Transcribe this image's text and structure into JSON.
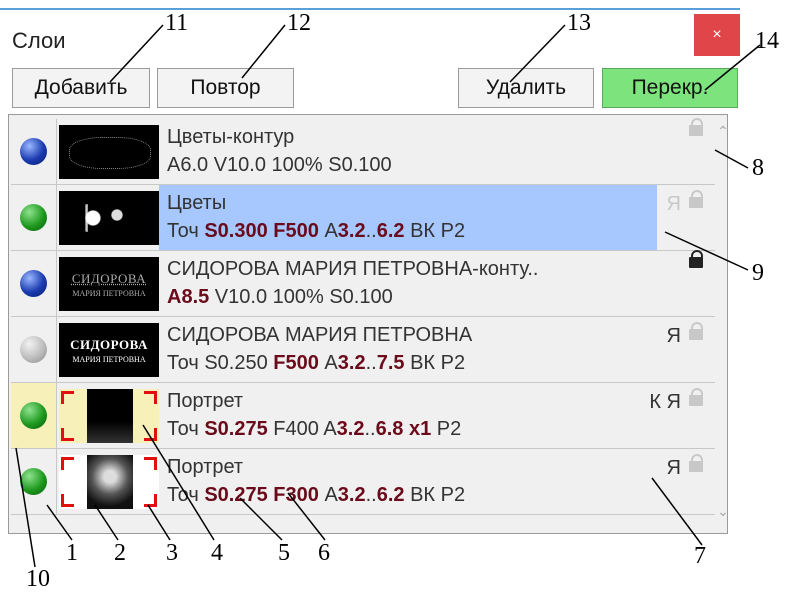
{
  "window": {
    "title": "Слои",
    "close_label": "×"
  },
  "toolbar": {
    "add": "Добавить",
    "repeat": "Повтор",
    "delete": "Удалить",
    "overlap": "Перекр."
  },
  "layers": [
    {
      "dot": "blue",
      "name": "Цветы-контур",
      "params_plain": "A6.0 V10.0 100% S0.100",
      "flags_text": "",
      "lock": "dim",
      "thumb": "flowers-outline"
    },
    {
      "dot": "green",
      "name": "Цветы",
      "params_rich": [
        [
          "Точ ",
          false
        ],
        [
          "S0.300 ",
          true
        ],
        [
          "F500 ",
          true
        ],
        [
          "A",
          false
        ],
        [
          "3.2",
          true
        ],
        [
          "..",
          false
        ],
        [
          "6.2",
          true
        ],
        [
          " ВК Р2",
          false
        ]
      ],
      "flags_text": "Я",
      "lock": "dim",
      "selected": true,
      "thumb": "flowers"
    },
    {
      "dot": "blue",
      "name": "СИДОРОВА МАРИЯ ПЕТРОВНА-конту..",
      "params_rich": [
        [
          "A8.5",
          true
        ],
        [
          " V10.0 100% S0.100",
          false
        ]
      ],
      "flags_text": "",
      "lock": "dark",
      "thumb": "text-outline"
    },
    {
      "dot": "grey",
      "name": "СИДОРОВА МАРИЯ ПЕТРОВНА",
      "params_rich": [
        [
          "Точ S0.250 ",
          false
        ],
        [
          "F500 ",
          true
        ],
        [
          "A",
          false
        ],
        [
          "3.2",
          true
        ],
        [
          "..",
          false
        ],
        [
          "7.5",
          true
        ],
        [
          " ВК Р2",
          false
        ]
      ],
      "flags_text": "Я",
      "lock": "dim",
      "thumb": "text"
    },
    {
      "dot": "green",
      "name": "Портрет",
      "params_rich": [
        [
          "Точ ",
          false
        ],
        [
          "S0.275 ",
          true
        ],
        [
          "F400 A",
          false
        ],
        [
          "3.2",
          true
        ],
        [
          "..",
          false
        ],
        [
          "6.8 x1",
          true
        ],
        [
          " Р2",
          false
        ]
      ],
      "flags_text": "К Я",
      "lock": "dim",
      "highlight": true,
      "thumb": "portrait-dark"
    },
    {
      "dot": "green",
      "name": "Портрет",
      "params_rich": [
        [
          "Точ ",
          false
        ],
        [
          "S0.275 ",
          true
        ],
        [
          "F300 ",
          true
        ],
        [
          "A",
          false
        ],
        [
          "3.2",
          true
        ],
        [
          "..",
          false
        ],
        [
          "6.2",
          true
        ],
        [
          " ВК Р2",
          false
        ]
      ],
      "flags_text": "Я",
      "lock": "dim",
      "thumb": "portrait"
    }
  ],
  "thumb_text": {
    "surname": "СИДОРОВА",
    "names": "МАРИЯ ПЕТРОВНА"
  },
  "callouts": [
    "1",
    "2",
    "3",
    "4",
    "5",
    "6",
    "7",
    "8",
    "9",
    "10",
    "11",
    "12",
    "13",
    "14"
  ],
  "colors": {
    "selected_row": "#a6c8ff",
    "highlight_cell": "#f7f0b8",
    "overlap_button": "#7de37d",
    "close_button": "#e0454a",
    "bold_value": "#6a0a1a"
  }
}
